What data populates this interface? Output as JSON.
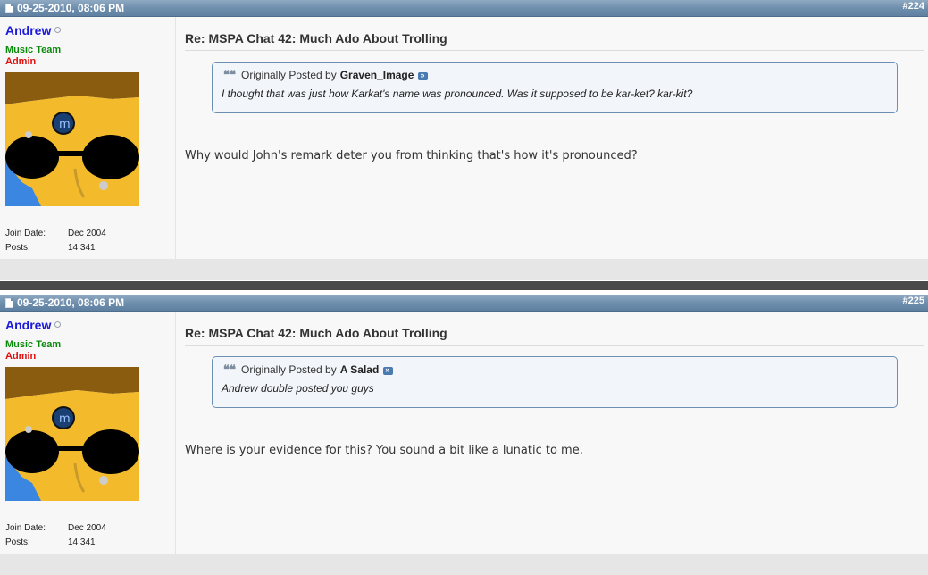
{
  "posts": [
    {
      "date": "09-25-2010, 08:06 PM",
      "number": "#224",
      "user": {
        "name": "Andrew",
        "rank1": "Music Team",
        "rank2": "Admin",
        "join_label": "Join Date:",
        "join_value": "Dec 2004",
        "posts_label": "Posts:",
        "posts_value": "14,341"
      },
      "title": "Re: MSPA Chat 42: Much Ado About Trolling",
      "quote": {
        "prefix": "Originally Posted by",
        "poster": "Graven_Image",
        "text": "I thought that was just how Karkat's name was pronounced. Was it supposed to be kar-ket? kar-kit?"
      },
      "message": "Why would John's remark deter you from thinking that's how it's pronounced?"
    },
    {
      "date": "09-25-2010, 08:06 PM",
      "number": "#225",
      "user": {
        "name": "Andrew",
        "rank1": "Music Team",
        "rank2": "Admin",
        "join_label": "Join Date:",
        "join_value": "Dec 2004",
        "posts_label": "Posts:",
        "posts_value": "14,341"
      },
      "title": "Re: MSPA Chat 42: Much Ado About Trolling",
      "quote": {
        "prefix": "Originally Posted by",
        "poster": "A Salad",
        "text": "Andrew double posted you guys"
      },
      "message": "Where is your evidence for this? You sound a bit like a lunatic to me."
    }
  ],
  "icons": {
    "post_icon": "document-icon",
    "online_status": "offline-status-icon",
    "quote_icon": "quote-icon",
    "view_post": "view-post-icon"
  },
  "colors": {
    "header_bar": "#6f8fae",
    "username": "#1b1bd9",
    "rank_music": "#0a8a0a",
    "rank_admin": "#e01010",
    "quote_border": "#6c8fb2"
  }
}
